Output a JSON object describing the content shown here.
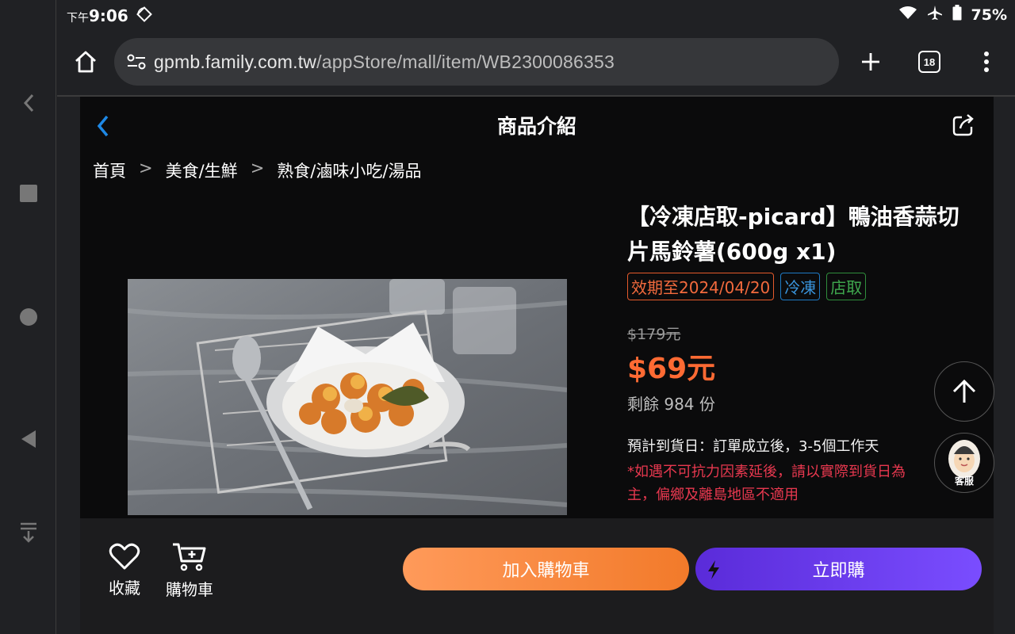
{
  "statusbar": {
    "ampm": "下午",
    "time": "9:06",
    "battery": "75%"
  },
  "browser": {
    "url_host": "gpmb.family.com.tw",
    "url_path": "/appStore/mall/item/WB2300086353",
    "tab_count": "18"
  },
  "header": {
    "title": "商品介紹"
  },
  "breadcrumb": {
    "items": [
      "首頁",
      "美食/生鮮",
      "熟食/滷味小吃/湯品"
    ],
    "separator": ">"
  },
  "product": {
    "name": "【冷凍店取-picard】鴨油香蒜切片馬鈴薯(600g x1)",
    "tags": {
      "expiry": "效期至2024/04/20",
      "frozen": "冷凍",
      "pickup": "店取"
    },
    "original_price": "$179元",
    "sale_price": "$69元",
    "stock": "剩餘 984 份",
    "delivery": "預計到貨日：訂單成立後，3-5個工作天",
    "notice": "*如遇不可抗力因素延後，請以實際到貨日為主，偏鄉及離島地區不適用"
  },
  "floating": {
    "cs_label": "客服"
  },
  "actions": {
    "favorite_label": "收藏",
    "cart_label": "購物車",
    "add_to_cart": "加入購物車",
    "buy_now": "立即購"
  },
  "colors": {
    "sale": "#ff6a33",
    "add_cart": "#f27a2a",
    "buy_now": "#6a3cf0",
    "notice": "#e8384f"
  }
}
